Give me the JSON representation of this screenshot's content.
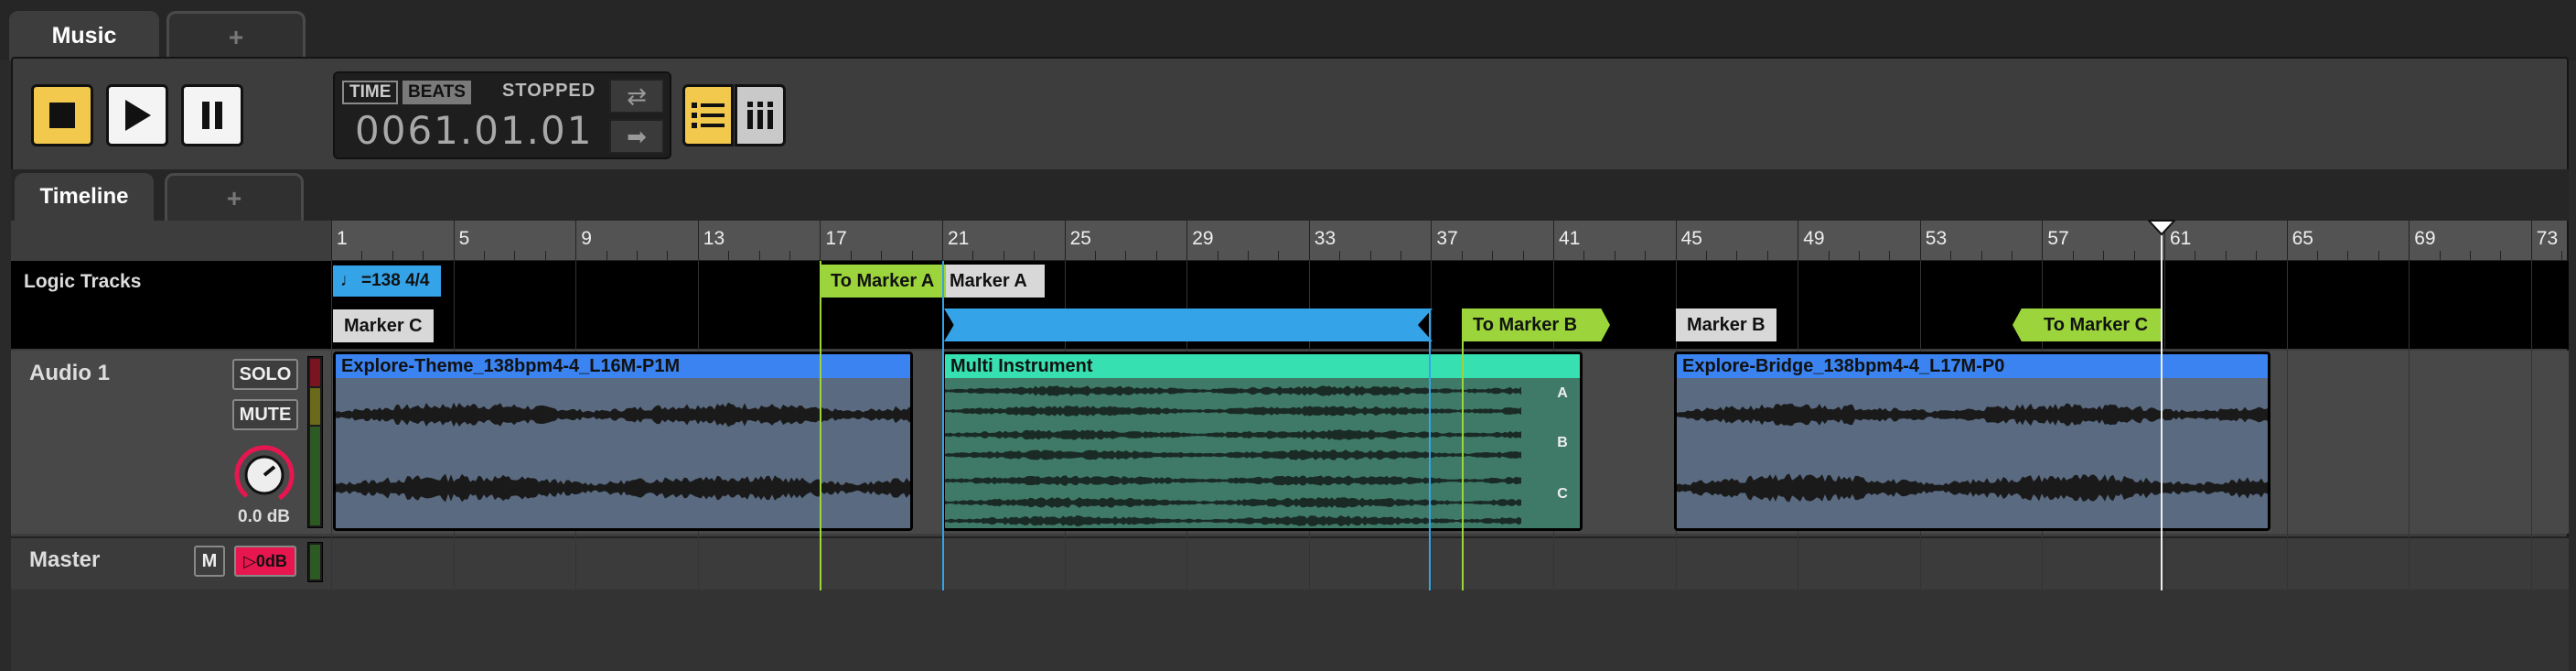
{
  "top_tabs": {
    "active": "Music",
    "add": "+"
  },
  "transport": {
    "stop_icon": "stop-icon",
    "play_icon": "play-icon",
    "pause_icon": "pause-icon",
    "time_label": "TIME",
    "beats_label": "BEATS",
    "status": "STOPPED",
    "position": "0061.01.01",
    "loop_icon": "loop-icon",
    "follow_icon": "arrow-right-icon",
    "list_view_icon": "list-view-icon",
    "mixer_view_icon": "mixer-view-icon"
  },
  "inner_tabs": {
    "active": "Timeline",
    "add": "+"
  },
  "ruler": {
    "labels": [
      "1",
      "5",
      "9",
      "13",
      "17",
      "21",
      "25",
      "29",
      "33",
      "37",
      "41",
      "45",
      "49",
      "53",
      "57",
      "61",
      "65",
      "69",
      "73"
    ]
  },
  "logic_tracks": {
    "label": "Logic Tracks",
    "tempo": "=138 4/4",
    "markers": {
      "marker_c": "Marker C",
      "to_marker_a": "To Marker A",
      "marker_a": "Marker A",
      "to_marker_b": "To Marker B",
      "marker_b": "Marker B",
      "to_marker_c": "To Marker C"
    }
  },
  "audio_track": {
    "name": "Audio 1",
    "solo": "SOLO",
    "mute": "MUTE",
    "volume": "0.0 dB",
    "clips": {
      "clip1": "Explore-Theme_138bpm4-4_L16M-P1M",
      "clip2": "Multi Instrument",
      "clip3": "Explore-Bridge_138bpm4-4_L17M-P0"
    },
    "layers": [
      "A",
      "B",
      "C"
    ]
  },
  "master_track": {
    "name": "Master",
    "mute": "M",
    "level": "0dB"
  },
  "colors": {
    "accent_yellow": "#f2c94c",
    "clip_blue": "#3a83f0",
    "clip_teal": "#36e0b0",
    "marker_green": "#9bd53b",
    "tempo_blue": "#34a3e8",
    "master_red": "#e8164f"
  }
}
